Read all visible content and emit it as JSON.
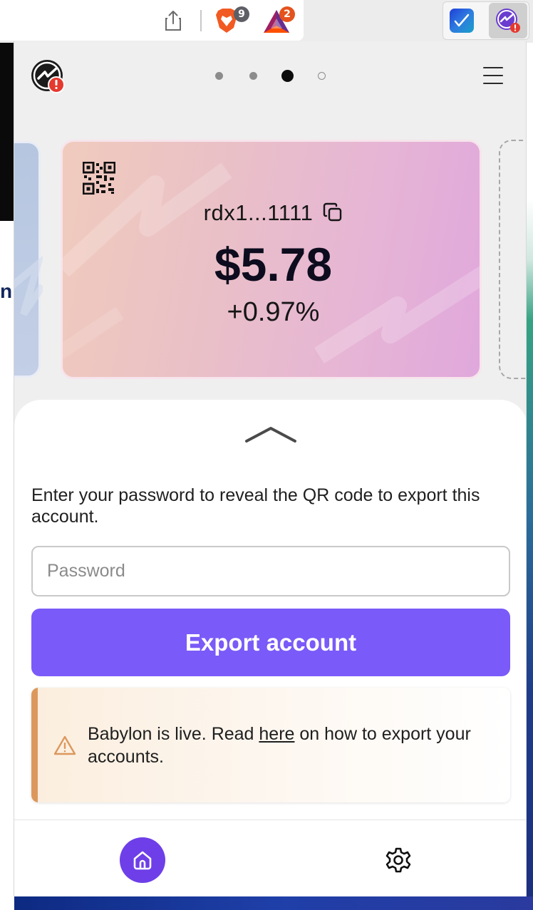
{
  "browser": {
    "brave_shields_count": "9",
    "brave_rewards_count": "2",
    "icons": [
      "share-icon",
      "brave-shields-icon",
      "brave-rewards-icon",
      "check-extension-icon",
      "radix-wallet-extension-icon"
    ]
  },
  "page_behind": {
    "partial_text": "n"
  },
  "wallet": {
    "pagination": {
      "total": 4,
      "active_index": 3
    },
    "account_card": {
      "address": "rdx1...1111",
      "balance": "$5.78",
      "change": "+0.97%"
    },
    "export_panel": {
      "instructions": "Enter your password to reveal the QR code to export this account.",
      "password_placeholder": "Password",
      "password_value": "",
      "export_button_label": "Export account"
    },
    "notice": {
      "text_before": "Babylon is live. Read ",
      "link_text": "here",
      "text_after": " on how to export your accounts."
    },
    "nav": {
      "items": [
        "home-icon",
        "settings-icon"
      ],
      "active": "home-icon"
    }
  },
  "colors": {
    "accent": "#7a5af8",
    "home_active": "#6e3fe8",
    "warning": "#dc985c",
    "alert_badge": "#e5392f"
  }
}
